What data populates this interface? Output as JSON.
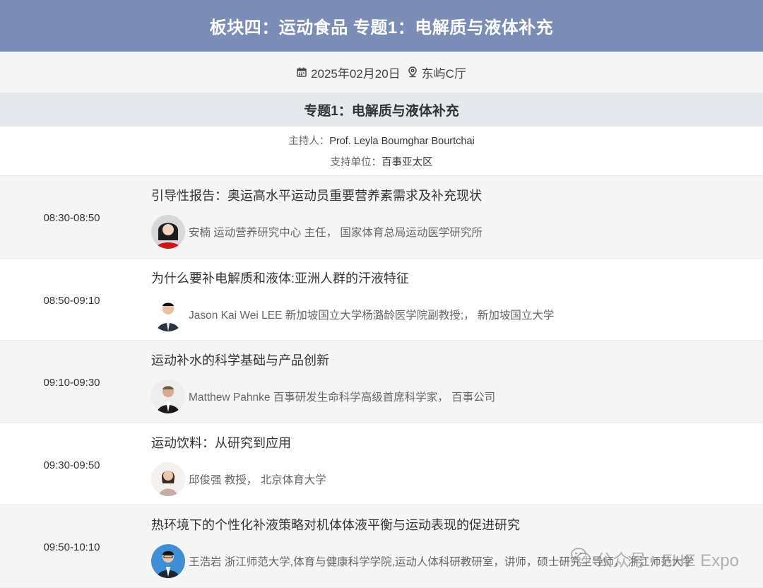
{
  "header": {
    "title": "板块四：运动食品 专题1：电解质与液体补充"
  },
  "meta": {
    "date": "2025年02月20日",
    "location": "东屿C厅"
  },
  "topic": {
    "title": "专题1：电解质与液体补充"
  },
  "info": {
    "host_label": "主持人：",
    "host": "Prof. Leyla Boumghar Bourtchai",
    "support_label": "支持单位：",
    "support": "百事亚太区"
  },
  "sessions": [
    {
      "time": "08:30-08:50",
      "title": "引导性报告：奥运高水平运动员重要营养素需求及补充现状",
      "speaker": "安楠 运动营养研究中心 主任， 国家体育总局运动医学研究所"
    },
    {
      "time": "08:50-09:10",
      "title": "为什么要补电解质和液体:亚洲人群的汗液特征",
      "speaker": "Jason Kai Wei LEE 新加坡国立大学杨潞龄医学院副教授;， 新加坡国立大学"
    },
    {
      "time": "09:10-09:30",
      "title": "运动补水的科学基础与产品创新",
      "speaker": "Matthew Pahnke 百事研发生命科学高级首席科学家， 百事公司"
    },
    {
      "time": "09:30-09:50",
      "title": "运动饮料：从研究到应用",
      "speaker": "邱俊强 教授， 北京体育大学"
    },
    {
      "time": "09:50-10:10",
      "title": "热环境下的个性化补液策略对机体体液平衡与运动表现的促进研究",
      "speaker": "王浩岩 浙江师范大学,体育与健康科学学院,运动人体科研教研室，讲师，硕士研究生导师， 浙江师范大学"
    }
  ],
  "watermark": {
    "text": "公众号 · FHE Expo"
  },
  "colors": {
    "header_bg": "#7b8cb7",
    "alt_row_bg": "#f5f5f5",
    "topic_bg": "#e5e8ec"
  }
}
